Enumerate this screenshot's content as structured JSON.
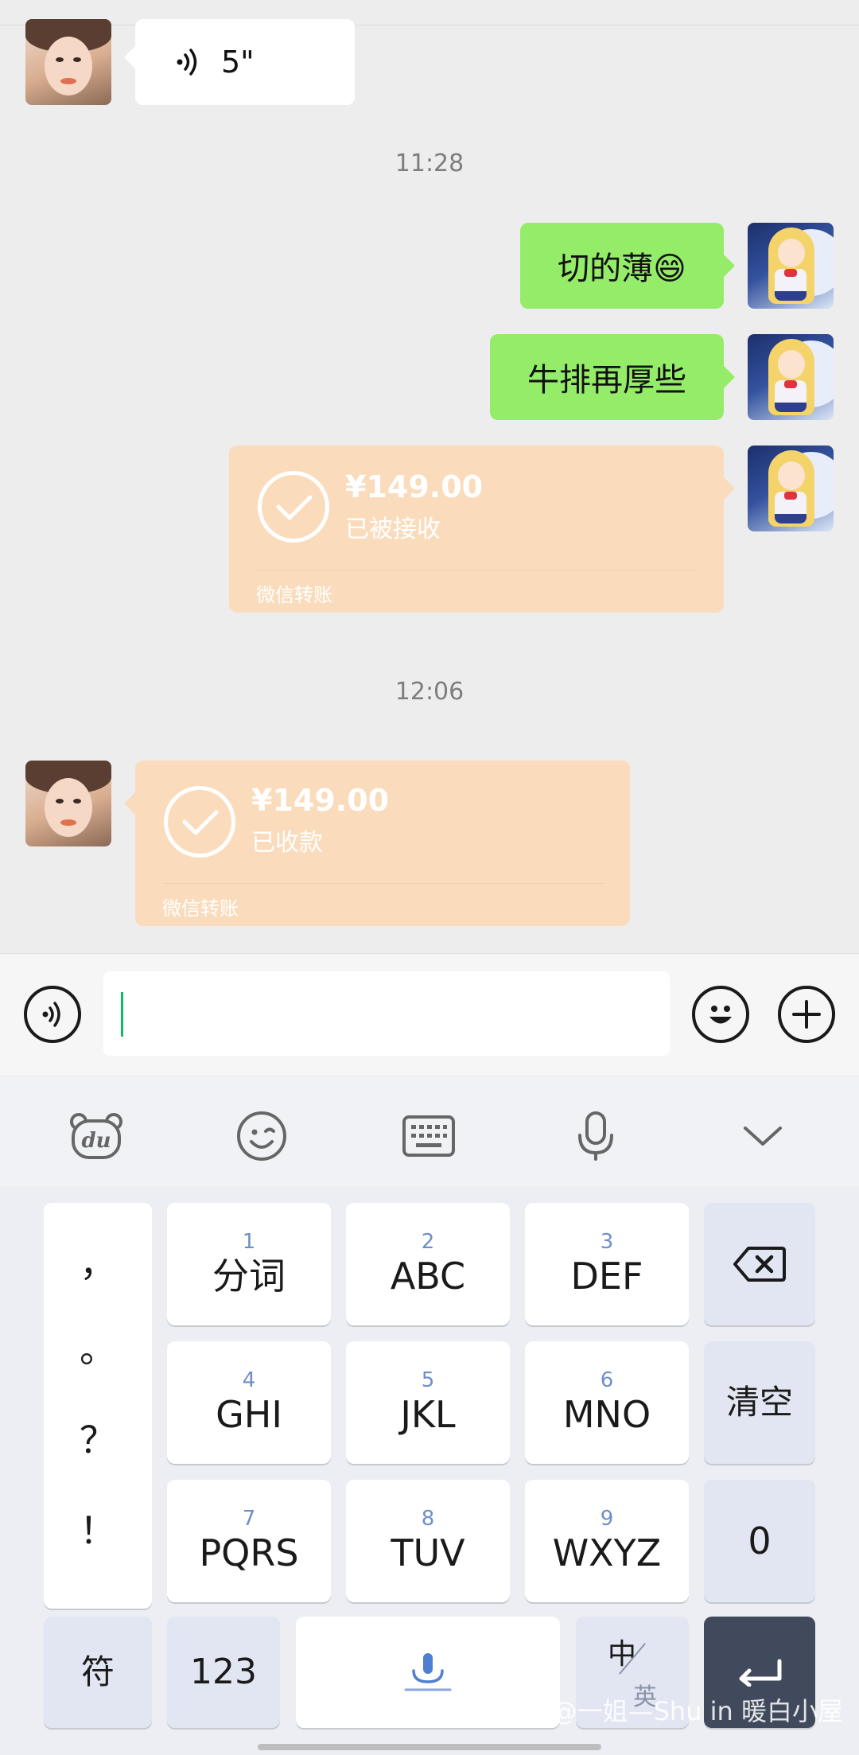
{
  "chat": {
    "voice_message": {
      "duration": "5\""
    },
    "time_1": "11:28",
    "sent_messages": [
      "切的薄😄",
      "牛排再厚些"
    ],
    "transfer_sent": {
      "amount": "¥149.00",
      "status": "已被接收",
      "brand": "微信转账"
    },
    "time_2": "12:06",
    "transfer_received": {
      "amount": "¥149.00",
      "status": "已收款",
      "brand": "微信转账"
    }
  },
  "input_bar": {
    "text_value": ""
  },
  "keyboard": {
    "toolbar": [
      "du-icon",
      "emoji-face-icon",
      "keyboard-icon",
      "microphone-icon",
      "chevron-down-icon"
    ],
    "punctuation": [
      "，",
      "。",
      "？",
      "！"
    ],
    "keys_row1": [
      {
        "num": "1",
        "label": "分词"
      },
      {
        "num": "2",
        "label": "ABC"
      },
      {
        "num": "3",
        "label": "DEF"
      }
    ],
    "keys_row2": [
      {
        "num": "4",
        "label": "GHI"
      },
      {
        "num": "5",
        "label": "JKL"
      },
      {
        "num": "6",
        "label": "MNO"
      }
    ],
    "keys_row3": [
      {
        "num": "7",
        "label": "PQRS"
      },
      {
        "num": "8",
        "label": "TUV"
      },
      {
        "num": "9",
        "label": "WXYZ"
      }
    ],
    "clear_label": "清空",
    "zero_label": "0",
    "symbol_label": "符",
    "number_mode_label": "123",
    "lang_primary": "中",
    "lang_secondary": "英"
  },
  "watermark": "@一姐—Shu in 暖白小屋",
  "colors": {
    "green_bubble": "#95ec69",
    "transfer": "#fadcbc",
    "caret": "#07c160",
    "enter_key": "#414a5c"
  }
}
